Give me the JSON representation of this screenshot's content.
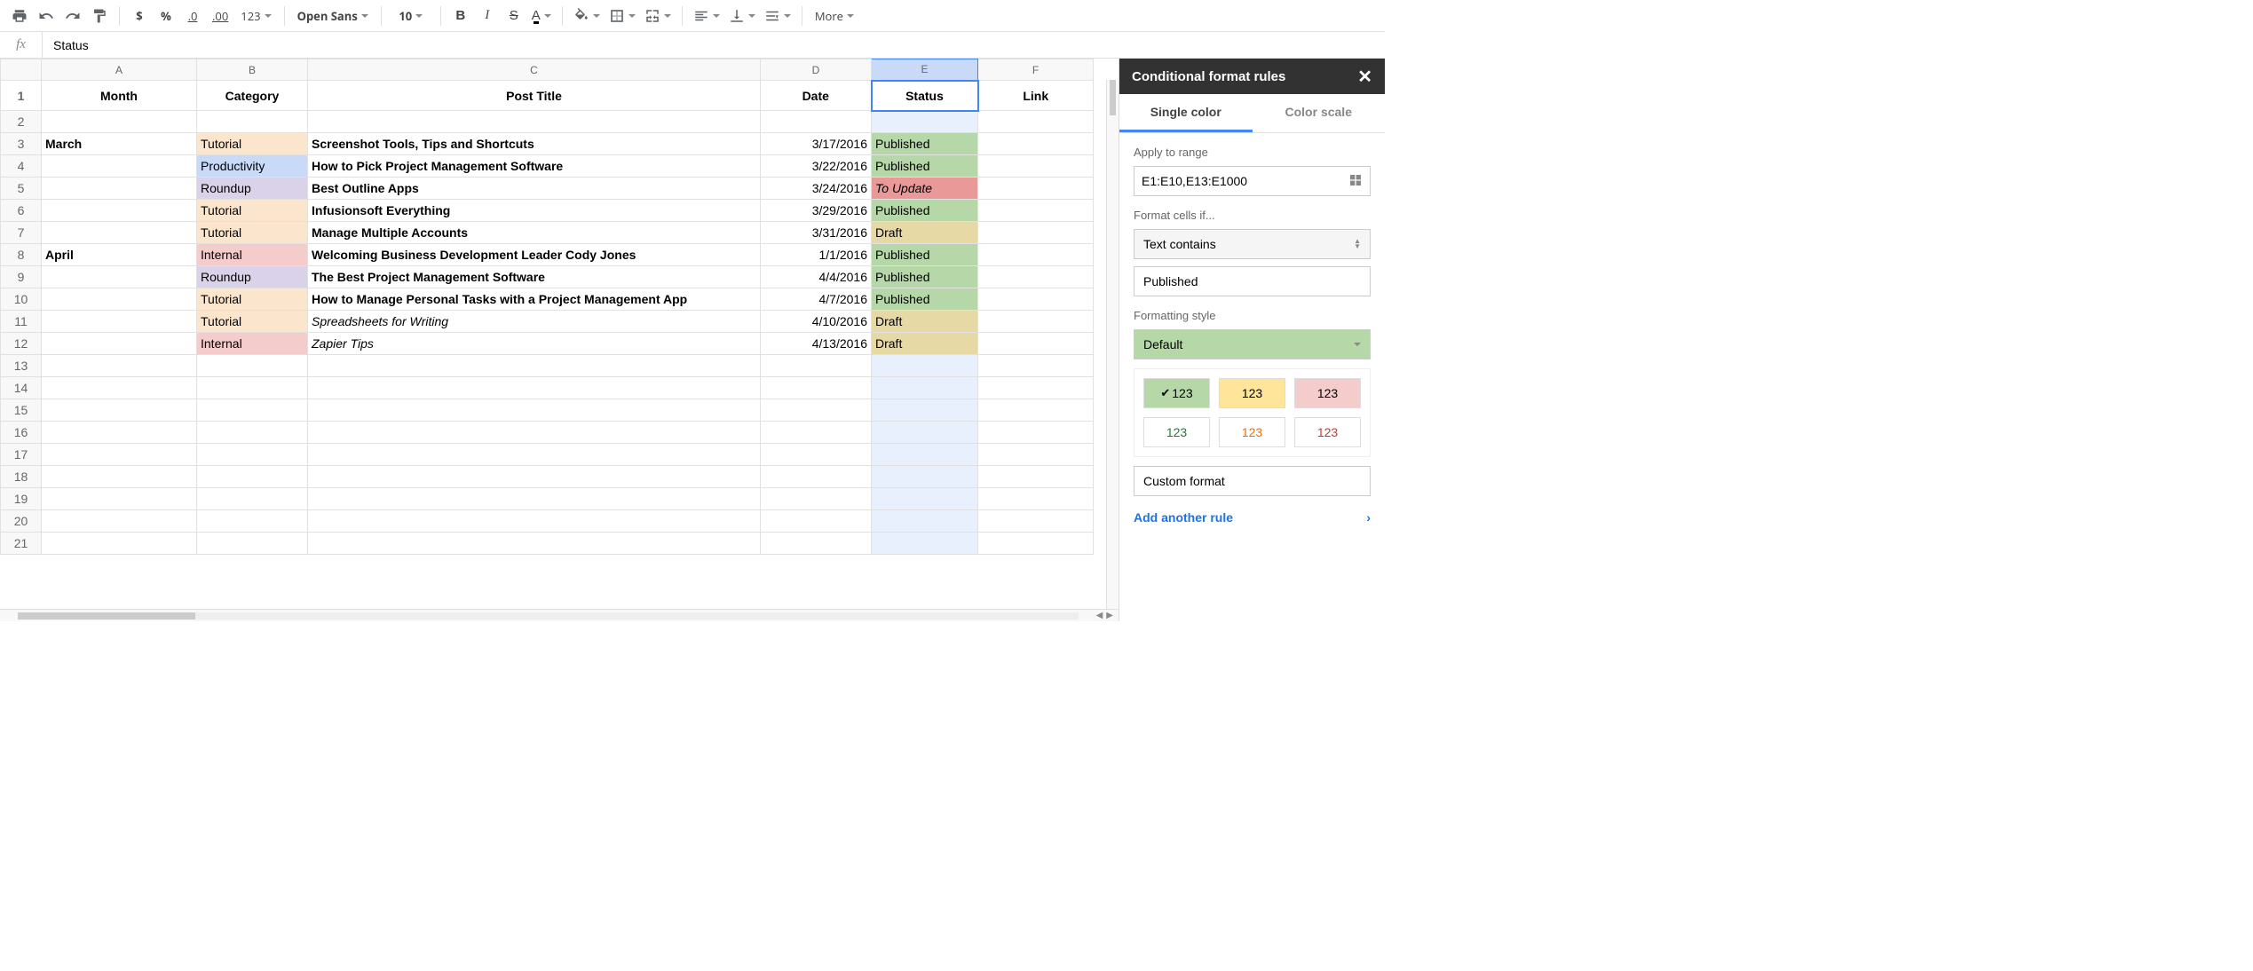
{
  "toolbar": {
    "currency": "$",
    "percent": "%",
    "dec_minus": ".0",
    "dec_plus": ".00",
    "format123": "123",
    "font": "Open Sans",
    "font_size": "10",
    "bold": "B",
    "italic": "I",
    "strike": "S",
    "text_color": "A",
    "more": "More"
  },
  "formula_bar": {
    "fx": "fx",
    "value": "Status"
  },
  "columns": [
    "A",
    "B",
    "C",
    "D",
    "E",
    "F"
  ],
  "headers": {
    "month": "Month",
    "category": "Category",
    "post_title": "Post Title",
    "date": "Date",
    "status": "Status",
    "link": "Link"
  },
  "rows": [
    {
      "n": "1"
    },
    {
      "n": "2"
    },
    {
      "n": "3",
      "month": "March",
      "category": "Tutorial",
      "cat_class": "cat-tutorial",
      "title": "Screenshot Tools, Tips and Shortcuts",
      "date": "3/17/2016",
      "status": "Published",
      "st_class": "status-published"
    },
    {
      "n": "4",
      "month": "",
      "category": "Productivity",
      "cat_class": "cat-productivity",
      "title": "How to Pick Project Management Software",
      "date": "3/22/2016",
      "status": "Published",
      "st_class": "status-published"
    },
    {
      "n": "5",
      "month": "",
      "category": "Roundup",
      "cat_class": "cat-roundup",
      "title": "Best Outline Apps",
      "date": "3/24/2016",
      "status": "To Update",
      "st_class": "status-toupdate"
    },
    {
      "n": "6",
      "month": "",
      "category": "Tutorial",
      "cat_class": "cat-tutorial",
      "title": "Infusionsoft Everything",
      "date": "3/29/2016",
      "status": "Published",
      "st_class": "status-published"
    },
    {
      "n": "7",
      "month": "",
      "category": "Tutorial",
      "cat_class": "cat-tutorial",
      "title": "Manage Multiple Accounts",
      "date": "3/31/2016",
      "status": "Draft",
      "st_class": "status-draft"
    },
    {
      "n": "8",
      "month": "April",
      "category": "Internal",
      "cat_class": "cat-internal",
      "title": "Welcoming Business Development Leader Cody Jones",
      "date": "1/1/2016",
      "status": "Published",
      "st_class": "status-published"
    },
    {
      "n": "9",
      "month": "",
      "category": "Roundup",
      "cat_class": "cat-roundup",
      "title": "The Best Project Management Software",
      "date": "4/4/2016",
      "status": "Published",
      "st_class": "status-published"
    },
    {
      "n": "10",
      "month": "",
      "category": "Tutorial",
      "cat_class": "cat-tutorial",
      "title": "How to Manage Personal Tasks with a Project Management App",
      "date": "4/7/2016",
      "status": "Published",
      "st_class": "status-published"
    },
    {
      "n": "11",
      "month": "",
      "category": "Tutorial",
      "cat_class": "cat-tutorial",
      "title": "Spreadsheets for Writing",
      "title_italic": true,
      "date": "4/10/2016",
      "status": "Draft",
      "st_class": "status-draft"
    },
    {
      "n": "12",
      "month": "",
      "category": "Internal",
      "cat_class": "cat-internal",
      "title": "Zapier Tips",
      "title_italic": true,
      "date": "4/13/2016",
      "status": "Draft",
      "st_class": "status-draft"
    },
    {
      "n": "13"
    },
    {
      "n": "14"
    },
    {
      "n": "15"
    },
    {
      "n": "16"
    },
    {
      "n": "17"
    },
    {
      "n": "18"
    },
    {
      "n": "19"
    },
    {
      "n": "20"
    },
    {
      "n": "21"
    }
  ],
  "sidepanel": {
    "title": "Conditional format rules",
    "tab_single": "Single color",
    "tab_scale": "Color scale",
    "apply_to_range": "Apply to range",
    "range_value": "E1:E10,E13:E1000",
    "format_if": "Format cells if...",
    "condition": "Text contains",
    "condition_value": "Published",
    "formatting_style": "Formatting style",
    "style_default": "Default",
    "swatch_label": "123",
    "custom_format": "Custom format",
    "add_rule": "Add another rule"
  }
}
